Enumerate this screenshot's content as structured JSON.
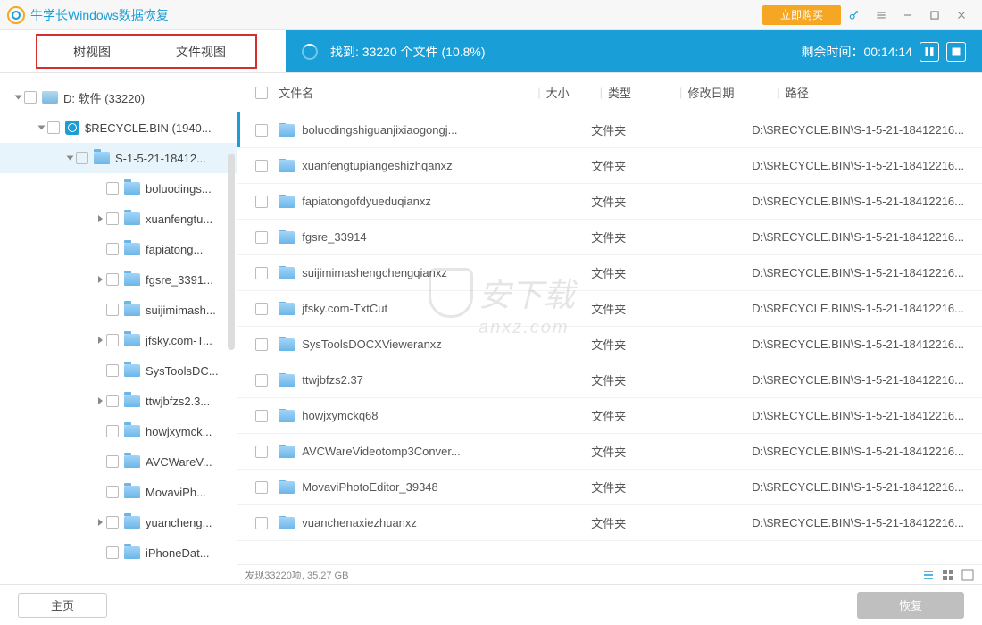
{
  "titlebar": {
    "app_title": "牛学长Windows数据恢复",
    "buy": "立即购买"
  },
  "tabs": {
    "tree": "树视图",
    "file": "文件视图"
  },
  "scan": {
    "prefix": "找到:",
    "count": "33220 个文件",
    "pct": "(10.8%)",
    "remain_label": "剩余时间：",
    "remain_time": "00:14:14"
  },
  "tree": {
    "drive": "D: 软件  (33220)",
    "recycle": "$RECYCLE.BIN  (1940...",
    "sid": "S-1-5-21-18412...",
    "items": [
      "boluodings...",
      "xuanfengtu...",
      "fapiatong...",
      "fgsre_3391...",
      "suijimimash...",
      "jfsky.com-T...",
      "SysToolsDC...",
      "ttwjbfzs2.3...",
      "howjxymck...",
      "AVCWareV...",
      "MovaviPh...",
      "yuancheng...",
      "iPhoneDat..."
    ],
    "expandable": [
      false,
      true,
      false,
      true,
      false,
      true,
      false,
      true,
      false,
      false,
      false,
      true,
      false
    ]
  },
  "cols": {
    "name": "文件名",
    "size": "大小",
    "type": "类型",
    "date": "修改日期",
    "path": "路径"
  },
  "files": [
    {
      "name": "boluodingshiguanjixiaogongj...",
      "type": "文件夹",
      "path": "D:\\$RECYCLE.BIN\\S-1-5-21-18412216..."
    },
    {
      "name": "xuanfengtupiangeshizhqanxz",
      "type": "文件夹",
      "path": "D:\\$RECYCLE.BIN\\S-1-5-21-18412216..."
    },
    {
      "name": "fapiatongofdyueduqianxz",
      "type": "文件夹",
      "path": "D:\\$RECYCLE.BIN\\S-1-5-21-18412216..."
    },
    {
      "name": "fgsre_33914",
      "type": "文件夹",
      "path": "D:\\$RECYCLE.BIN\\S-1-5-21-18412216..."
    },
    {
      "name": "suijimimashengchengqianxz",
      "type": "文件夹",
      "path": "D:\\$RECYCLE.BIN\\S-1-5-21-18412216..."
    },
    {
      "name": "jfsky.com-TxtCut",
      "type": "文件夹",
      "path": "D:\\$RECYCLE.BIN\\S-1-5-21-18412216..."
    },
    {
      "name": "SysToolsDOCXVieweranxz",
      "type": "文件夹",
      "path": "D:\\$RECYCLE.BIN\\S-1-5-21-18412216..."
    },
    {
      "name": "ttwjbfzs2.37",
      "type": "文件夹",
      "path": "D:\\$RECYCLE.BIN\\S-1-5-21-18412216..."
    },
    {
      "name": "howjxymckq68",
      "type": "文件夹",
      "path": "D:\\$RECYCLE.BIN\\S-1-5-21-18412216..."
    },
    {
      "name": "AVCWareVideotomp3Conver...",
      "type": "文件夹",
      "path": "D:\\$RECYCLE.BIN\\S-1-5-21-18412216..."
    },
    {
      "name": "MovaviPhotoEditor_39348",
      "type": "文件夹",
      "path": "D:\\$RECYCLE.BIN\\S-1-5-21-18412216..."
    },
    {
      "name": "vuanchenaxiezhuanxz",
      "type": "文件夹",
      "path": "D:\\$RECYCLE.BIN\\S-1-5-21-18412216..."
    }
  ],
  "status": {
    "text": "发现33220项, 35.27 GB"
  },
  "footer": {
    "home": "主页",
    "recover": "恢复"
  },
  "watermark": {
    "line1": "安下载",
    "line2": "anxz.com"
  }
}
